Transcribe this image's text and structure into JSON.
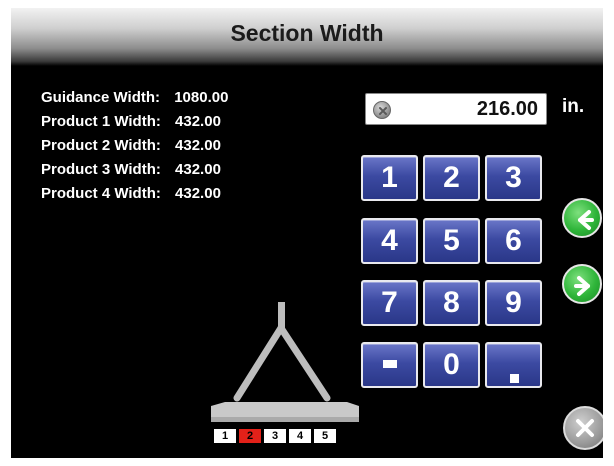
{
  "header": {
    "title": "Section Width"
  },
  "widths": [
    {
      "label": "Guidance Width:",
      "value": "1080.00"
    },
    {
      "label": "Product 1 Width:",
      "value": "432.00"
    },
    {
      "label": "Product 2 Width:",
      "value": "432.00"
    },
    {
      "label": "Product 3 Width:",
      "value": "432.00"
    },
    {
      "label": "Product 4 Width:",
      "value": "432.00"
    }
  ],
  "entry": {
    "value": "216.00",
    "unit": "in.",
    "clear_icon": "clear-circle-x-icon"
  },
  "keypad": {
    "k1": "1",
    "k2": "2",
    "k3": "3",
    "k4": "4",
    "k5": "5",
    "k6": "6",
    "k7": "7",
    "k8": "8",
    "k9": "9",
    "k0": "0",
    "minus": "-",
    "decimal": "."
  },
  "navigation": {
    "prev_icon": "arrow-left-icon",
    "next_icon": "arrow-right-icon",
    "close_icon": "close-x-icon"
  },
  "implement": {
    "sections": [
      "1",
      "2",
      "3",
      "4",
      "5"
    ],
    "selected_section": "2"
  },
  "colors": {
    "background": "#000000",
    "key_blue": "#3c4aa2",
    "nav_green": "#2fb53a",
    "active_section": "#e32119"
  }
}
